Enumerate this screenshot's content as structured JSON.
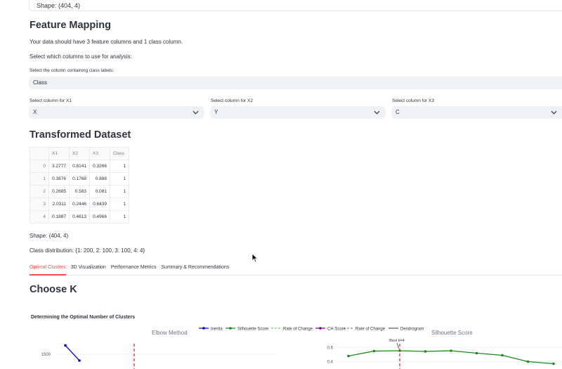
{
  "top_shape_text": "Shape: (404, 4)",
  "feature_mapping": {
    "title": "Feature Mapping",
    "intro": "Your data should have 3 feature columns and 1 class column.",
    "select_prompt": "Select which columns to use for analysis:",
    "class_label": "Select the column containing class labels:",
    "class_value": "Class",
    "x1_label": "Select column for X1",
    "x1_value": "X",
    "x2_label": "Select column for X2",
    "x2_value": "Y",
    "x3_label": "Select column for X3",
    "x3_value": "C"
  },
  "transformed": {
    "title": "Transformed Dataset",
    "columns": [
      "",
      "X1",
      "X2",
      "X3",
      "Class"
    ],
    "rows": [
      [
        "0",
        "3.2777",
        "0.8141",
        "0.3266",
        "1"
      ],
      [
        "1",
        "0.3876",
        "0.1768",
        "0.888",
        "1"
      ],
      [
        "2",
        "0.2685",
        "0.583",
        "0.081",
        "1"
      ],
      [
        "3",
        "2.0311",
        "0.2446",
        "0.6439",
        "1"
      ],
      [
        "4",
        "0.1887",
        "0.4613",
        "0.4966",
        "1"
      ]
    ],
    "shape": "Shape: (404, 4)",
    "class_distribution": "Class distribution: {1: 200, 2: 100, 3: 100, 4: 4}"
  },
  "tabs": [
    {
      "label": "Optimal Clusters",
      "active": true
    },
    {
      "label": "3D Visualization",
      "active": false
    },
    {
      "label": "Performance Metrics",
      "active": false
    },
    {
      "label": "Summary & Recommendations",
      "active": false
    }
  ],
  "choose_k": {
    "title": "Choose K"
  },
  "accent_color": "#ff4b4b",
  "chart_data": {
    "type": "line",
    "title": "Determining the Optimal Number of Clusters",
    "subplots": [
      "Elbow Method",
      "Silhouette Score"
    ],
    "legend": [
      "Inertia",
      "Silhouette Score",
      "Rate of Change",
      "CH Score",
      "Rate of Change",
      "Dendrogram"
    ],
    "legend_placement": "top",
    "elbow": {
      "y_ticks": [
        "1500"
      ],
      "series": [
        {
          "name": "Inertia",
          "x": [
            2,
            3
          ],
          "y": [
            1640,
            1400
          ]
        }
      ],
      "best_k_line": "dashed-red"
    },
    "silhouette": {
      "y_ticks": [
        "0.6",
        "0.4"
      ],
      "annotation": "Best k=4",
      "series": [
        {
          "name": "Silhouette Score",
          "x": [
            2,
            3,
            4,
            5,
            6,
            7,
            8,
            9,
            10
          ],
          "y": [
            0.48,
            0.55,
            0.555,
            0.545,
            0.555,
            0.52,
            0.49,
            0.4,
            0.37
          ]
        }
      ],
      "ylim": [
        0.35,
        0.65
      ]
    },
    "colors": {
      "inertia": "#0000cc",
      "silhouette": "#1a8a1a",
      "ch": "#800080",
      "best": "#e03030",
      "dendrogram": "#555555"
    }
  }
}
